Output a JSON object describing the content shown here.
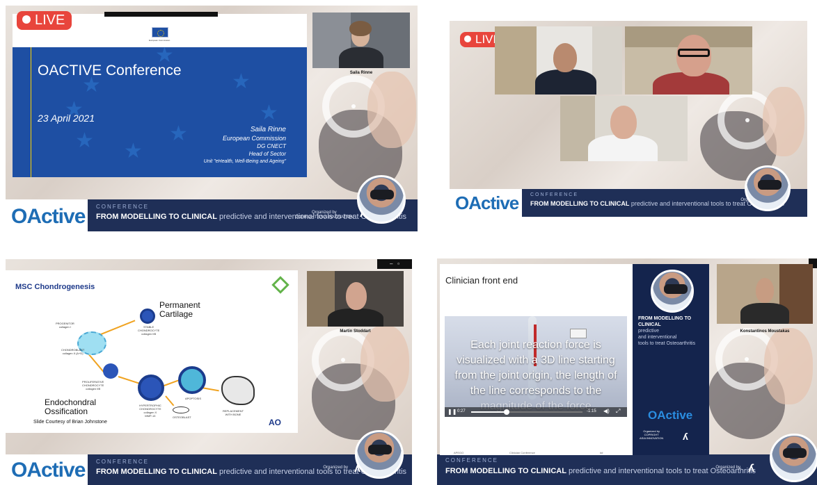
{
  "panel1": {
    "live": "LIVE",
    "slide_title": "OACTIVE Conference",
    "date": "23 April 2021",
    "eu_label": "European Commission",
    "speaker": [
      "Saila Rinne",
      "European Commission",
      "DG CNECT",
      "Head of Sector",
      "Unit \"eHealth, Well-Being and Ageing\""
    ],
    "cam_name": "Saila Rinne"
  },
  "panel2": {
    "live": "LIVE"
  },
  "panel3": {
    "slide_title": "MSC Chondrogenesis",
    "permanent": [
      "Permanent",
      "Cartilage"
    ],
    "endochondral": [
      "Endochondral",
      "Ossification"
    ],
    "courtesy": "Slide Courtesy of Brian Johnstone",
    "labels": {
      "progenitor": [
        "PROGENITOR",
        "collagen I"
      ],
      "stable": [
        "STABLE",
        "CHONDROCYTE",
        "collagen IIB"
      ],
      "chondroblast": [
        "CHONDROBLAST",
        "collagen II (A+D)"
      ],
      "proliferative": [
        "PROLIFERATIVE",
        "CHONDROCYTE",
        "collagen IIB"
      ],
      "hypertrophic": [
        "HYPERTROPHIC",
        "CHONDROCYTE",
        "collagen X",
        "MMP-13"
      ],
      "apoptosis": "APOPTOSIS",
      "osteoblast": "OSTEOBLAST",
      "replacement": [
        "REPLACEMENT",
        "WITH BONE"
      ]
    },
    "ao": "AO",
    "cam_name": "Martin Stoddart"
  },
  "panel4": {
    "slide_title": "Clinician front end",
    "subtitle_lines": [
      "Each joint reaction force is",
      "visualized with a 3D line starting",
      "from the joint origin, the length of",
      "the line corresponds to the",
      "magnitude of the force"
    ],
    "time_left": "0:27",
    "time_right": "-1:15",
    "card_title": "FROM MODELLING TO CLINICAL",
    "card_rest": [
      "predictive",
      "and interventional",
      "tools to treat Osteoarthritis"
    ],
    "card_logo": "OActive",
    "card_org": [
      "Organized by",
      "COPRIGHT",
      "ASIA INNOVATION"
    ],
    "cam_name": "Konstantinos Moustakas",
    "footer_small": [
      "APEGO",
      "Clinician Conference",
      "##"
    ]
  },
  "banner": {
    "logo": "OActive",
    "conference": "CONFERENCE",
    "tag_bold": "FROM MODELLING TO CLINICAL",
    "tag_rest": " predictive and interventional tools to treat Osteoarthritis",
    "organized": "Organized by",
    "org_name": "COPRIGHT ASIA INNOVATION"
  },
  "colors": {
    "live": "#e8453c",
    "banner": "#1f2f57",
    "eu_blue": "#1e4fa3",
    "logo_blue": "#1e6db5"
  }
}
